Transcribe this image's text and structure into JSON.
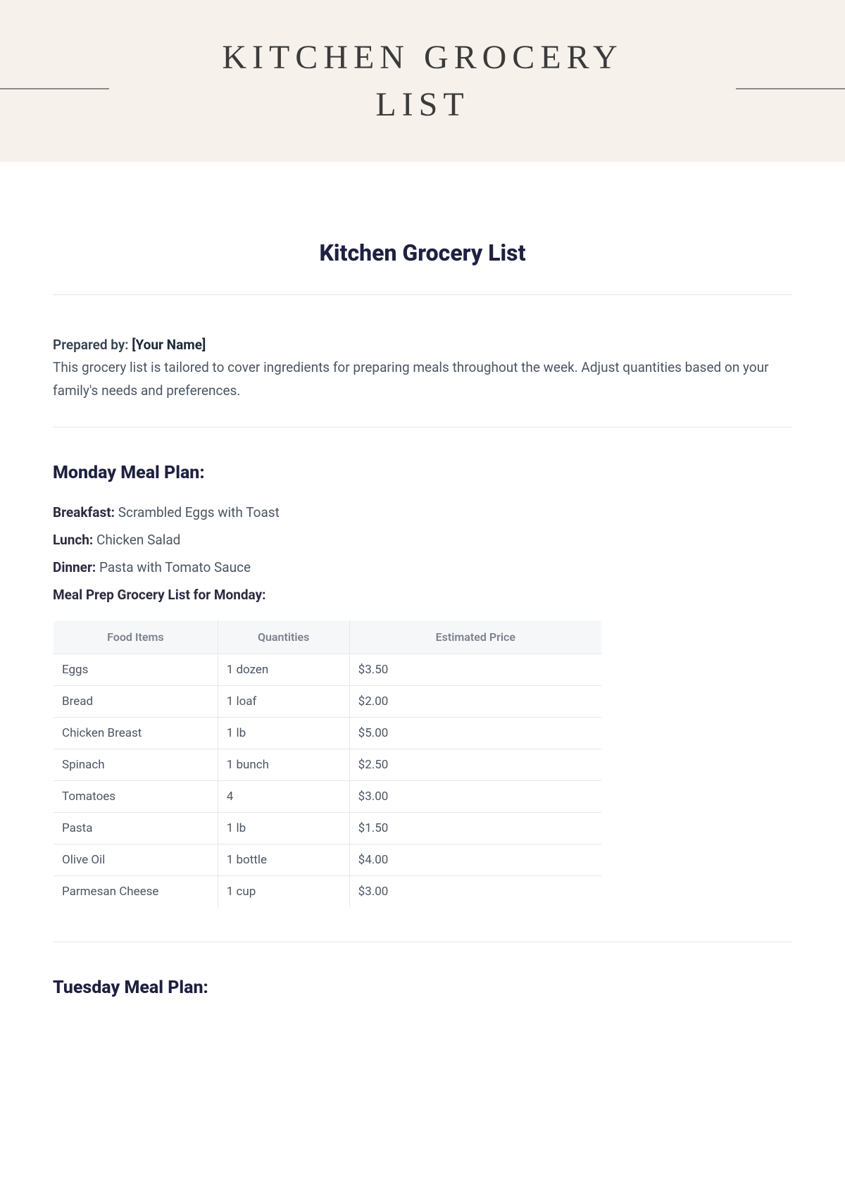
{
  "banner": {
    "title": "KITCHEN GROCERY LIST"
  },
  "doc": {
    "title": "Kitchen Grocery List",
    "prepared_label": "Prepared by: ",
    "prepared_value": "[Your Name]",
    "intro_text": "This grocery list is tailored to cover ingredients for preparing meals throughout the week. Adjust quantities based on your family's needs and preferences."
  },
  "monday": {
    "heading": "Monday Meal Plan:",
    "breakfast_label": "Breakfast:",
    "breakfast_value": " Scrambled Eggs with Toast",
    "lunch_label": "Lunch:",
    "lunch_value": " Chicken Salad",
    "dinner_label": "Dinner:",
    "dinner_value": " Pasta with Tomato Sauce",
    "table_label": "Meal Prep Grocery List for Monday:",
    "headers": {
      "col1": "Food Items",
      "col2": "Quantities",
      "col3": "Estimated Price"
    },
    "rows": [
      {
        "item": "Eggs",
        "qty": "1 dozen",
        "price": "$3.50"
      },
      {
        "item": "Bread",
        "qty": "1 loaf",
        "price": "$2.00"
      },
      {
        "item": "Chicken Breast",
        "qty": "1 lb",
        "price": "$5.00"
      },
      {
        "item": "Spinach",
        "qty": "1 bunch",
        "price": "$2.50"
      },
      {
        "item": "Tomatoes",
        "qty": "4",
        "price": "$3.00"
      },
      {
        "item": "Pasta",
        "qty": "1 lb",
        "price": "$1.50"
      },
      {
        "item": "Olive Oil",
        "qty": "1 bottle",
        "price": "$4.00"
      },
      {
        "item": "Parmesan Cheese",
        "qty": "1 cup",
        "price": "$3.00"
      }
    ]
  },
  "tuesday": {
    "heading": "Tuesday Meal Plan:"
  }
}
